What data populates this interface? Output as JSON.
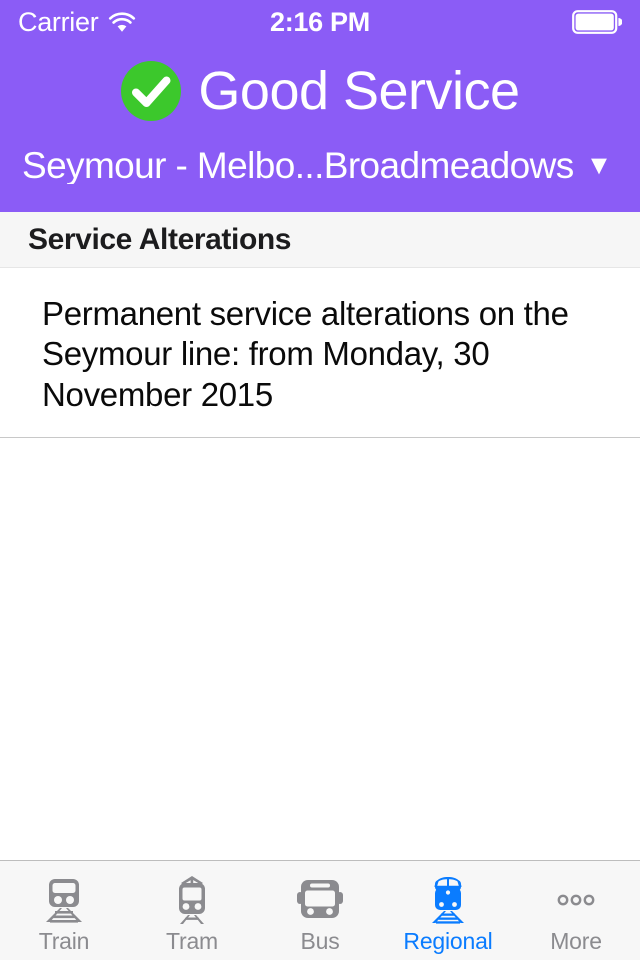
{
  "status_bar": {
    "carrier": "Carrier",
    "wifi_icon": "wifi-icon",
    "time": "2:16 PM",
    "battery_icon": "battery-icon"
  },
  "header": {
    "background_color": "#8B5CF6",
    "service_status": {
      "icon": "check-circle-icon",
      "icon_color": "#3CC82C",
      "label": "Good Service"
    },
    "route_selector": {
      "label": "Seymour - Melbo...Broadmeadows",
      "caret_icon": "chevron-down-icon"
    }
  },
  "section": {
    "title": "Service Alterations"
  },
  "alterations": [
    {
      "text": "Permanent service alterations on the Seymour line: from Monday, 30 November 2015"
    }
  ],
  "tabbar": {
    "active_color": "#0a7cff",
    "inactive_color": "#8B8B8F",
    "tabs": [
      {
        "label": "Train",
        "icon": "train-icon",
        "active": false
      },
      {
        "label": "Tram",
        "icon": "tram-icon",
        "active": false
      },
      {
        "label": "Bus",
        "icon": "bus-icon",
        "active": false
      },
      {
        "label": "Regional",
        "icon": "regional-train-icon",
        "active": true
      },
      {
        "label": "More",
        "icon": "ellipsis-icon",
        "active": false
      }
    ]
  }
}
